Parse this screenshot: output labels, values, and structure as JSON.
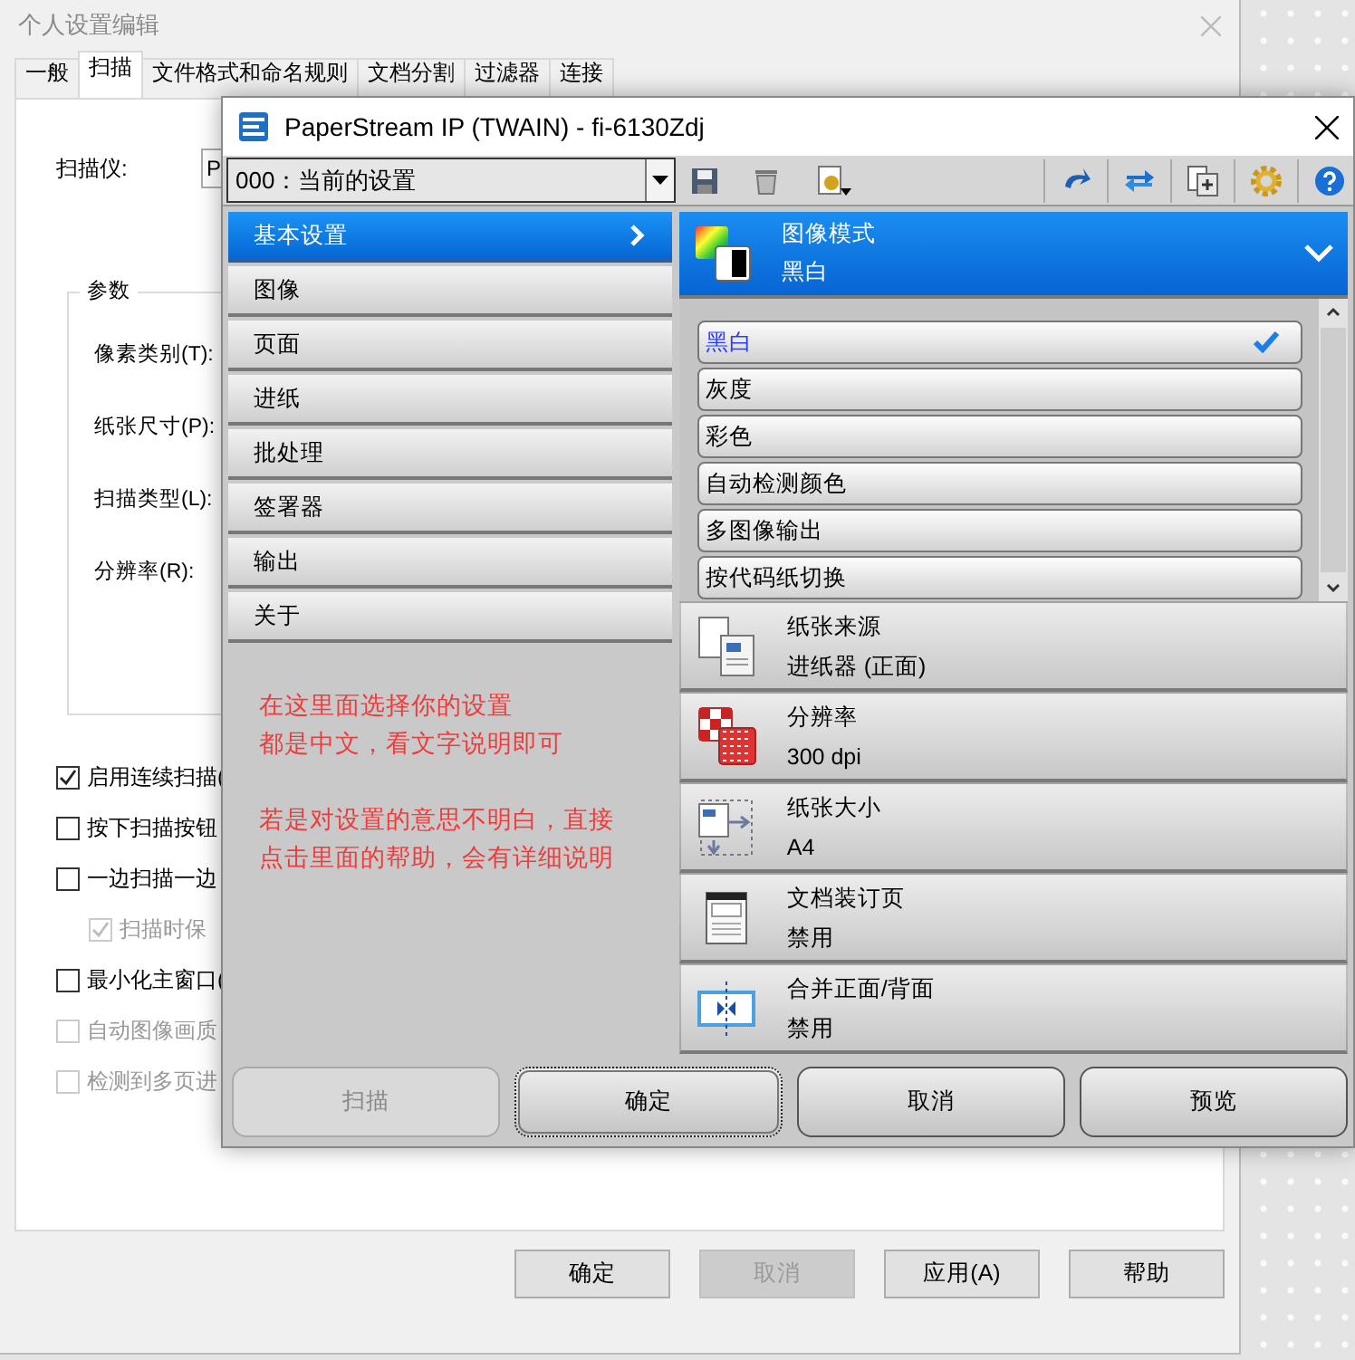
{
  "back_window": {
    "title": "个人设置编辑",
    "tabs": [
      {
        "label": "一般",
        "selected": false
      },
      {
        "label": "扫描",
        "selected": true
      },
      {
        "label": "文件格式和命名规则",
        "selected": false
      },
      {
        "label": "文档分割",
        "selected": false
      },
      {
        "label": "过滤器",
        "selected": false
      },
      {
        "label": "连接",
        "selected": false
      }
    ],
    "scanner_label": "扫描仪:",
    "scanner_value": "P",
    "group_title": "参数",
    "params": [
      "像素类别(T):",
      "纸张尺寸(P):",
      "扫描类型(L):",
      "分辨率(R):"
    ],
    "options": [
      {
        "label": "启用连续扫描(",
        "checked": true,
        "disabled": false
      },
      {
        "label": "按下扫描按钮",
        "checked": false,
        "disabled": false
      },
      {
        "label": "一边扫描一边",
        "checked": false,
        "disabled": false,
        "children": [
          {
            "label": "扫描时保",
            "checked": true,
            "disabled": true
          }
        ]
      },
      {
        "label": "最小化主窗口(",
        "checked": false,
        "disabled": false
      },
      {
        "label": "自动图像画质",
        "checked": false,
        "disabled": true
      },
      {
        "label": "检测到多页进",
        "checked": false,
        "disabled": true
      }
    ],
    "buttons": [
      {
        "label": "确定",
        "disabled": false
      },
      {
        "label": "取消",
        "disabled": true
      },
      {
        "label": "应用(A)",
        "disabled": false
      },
      {
        "label": "帮助",
        "disabled": false
      }
    ]
  },
  "front_window": {
    "title": "PaperStream IP (TWAIN) - fi-6130Zdj",
    "profile": "000：当前的设置",
    "menu": [
      {
        "label": "基本设置",
        "selected": true
      },
      {
        "label": "图像",
        "selected": false
      },
      {
        "label": "页面",
        "selected": false
      },
      {
        "label": "进纸",
        "selected": false
      },
      {
        "label": "批处理",
        "selected": false
      },
      {
        "label": "签署器",
        "selected": false
      },
      {
        "label": "输出",
        "selected": false
      },
      {
        "label": "关于",
        "selected": false
      }
    ],
    "note": [
      [
        "在这里面选择你的设置",
        "都是中文，看文字说明即可"
      ],
      [
        "若是对设置的意思不明白，直接",
        "点击里面的帮助，会有详细说明"
      ]
    ],
    "expanded_setting": {
      "title": "图像模式",
      "value": "黑白",
      "expanded": true
    },
    "choices": [
      {
        "label": "黑白",
        "selected": true
      },
      {
        "label": "灰度",
        "selected": false
      },
      {
        "label": "彩色",
        "selected": false
      },
      {
        "label": "自动检测颜色",
        "selected": false
      },
      {
        "label": "多图像输出",
        "selected": false
      },
      {
        "label": "按代码纸切换",
        "selected": false
      }
    ],
    "settings": [
      {
        "kind": "paper-source",
        "title": "纸张来源",
        "value": "进纸器 (正面)"
      },
      {
        "kind": "resolution",
        "title": "分辨率",
        "value": "300 dpi"
      },
      {
        "kind": "paper-size",
        "title": "纸张大小",
        "value": "A4"
      },
      {
        "kind": "endorser",
        "title": "文档装订页",
        "value": "禁用"
      },
      {
        "kind": "merge",
        "title": "合并正面/背面",
        "value": "禁用"
      }
    ],
    "buttons": [
      {
        "label": "扫描",
        "disabled": true,
        "focused": false
      },
      {
        "label": "确定",
        "disabled": false,
        "focused": true
      },
      {
        "label": "取消",
        "disabled": false,
        "focused": false
      },
      {
        "label": "预览",
        "disabled": false,
        "focused": false
      }
    ]
  }
}
